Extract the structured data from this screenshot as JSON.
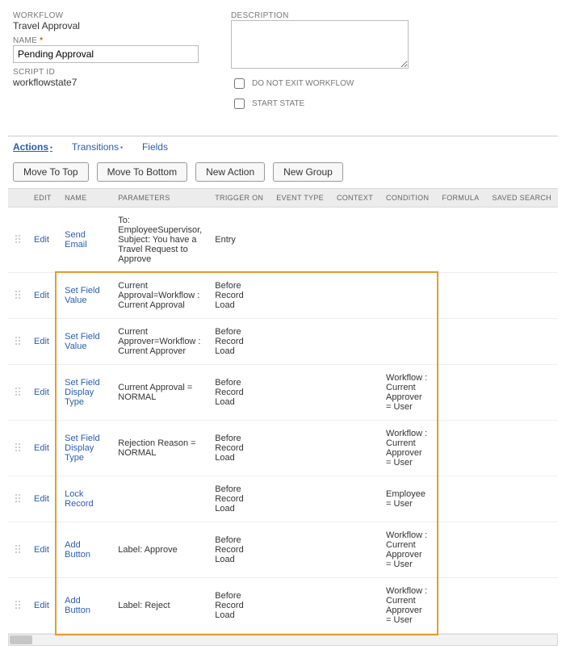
{
  "form": {
    "workflow_label": "WORKFLOW",
    "workflow_value": "Travel Approval",
    "name_label": "NAME",
    "name_value": "Pending Approval",
    "scriptid_label": "SCRIPT ID",
    "scriptid_value": "workflowstate7",
    "description_label": "DESCRIPTION",
    "description_value": "",
    "donotexit_label": "DO NOT EXIT WORKFLOW",
    "startstate_label": "START STATE"
  },
  "tabs": {
    "actions": "Actions",
    "transitions": "Transitions",
    "fields": "Fields"
  },
  "buttons": {
    "move_top": "Move To Top",
    "move_bottom": "Move To Bottom",
    "new_action": "New Action",
    "new_group": "New Group"
  },
  "columns": {
    "edit": "EDIT",
    "name": "NAME",
    "parameters": "PARAMETERS",
    "trigger_on": "TRIGGER ON",
    "event_type": "EVENT TYPE",
    "context": "CONTEXT",
    "condition": "CONDITION",
    "formula": "FORMULA",
    "saved_search": "SAVED SEARCH"
  },
  "edit_label": "Edit",
  "rows": [
    {
      "name": "Send Email",
      "parameters": "To: EmployeeSupervisor, Subject: You have a Travel Request to Approve",
      "trigger": "Entry",
      "event": "",
      "context": "",
      "condition": "",
      "formula": "",
      "saved_search": ""
    },
    {
      "name": "Set Field Value",
      "parameters": "Current Approval=Workflow : Current Approval",
      "trigger": "Before Record Load",
      "event": "",
      "context": "",
      "condition": "",
      "formula": "",
      "saved_search": ""
    },
    {
      "name": "Set Field Value",
      "parameters": "Current Approver=Workflow : Current Approver",
      "trigger": "Before Record Load",
      "event": "",
      "context": "",
      "condition": "",
      "formula": "",
      "saved_search": ""
    },
    {
      "name": "Set Field Display Type",
      "parameters": "Current Approval = NORMAL",
      "trigger": "Before Record Load",
      "event": "",
      "context": "",
      "condition": "Workflow : Current Approver = User",
      "formula": "",
      "saved_search": ""
    },
    {
      "name": "Set Field Display Type",
      "parameters": "Rejection Reason = NORMAL",
      "trigger": "Before Record Load",
      "event": "",
      "context": "",
      "condition": "Workflow : Current Approver = User",
      "formula": "",
      "saved_search": ""
    },
    {
      "name": "Lock Record",
      "parameters": "",
      "trigger": "Before Record Load",
      "event": "",
      "context": "",
      "condition": "Employee = User",
      "formula": "",
      "saved_search": ""
    },
    {
      "name": "Add Button",
      "parameters": "Label: Approve",
      "trigger": "Before Record Load",
      "event": "",
      "context": "",
      "condition": "Workflow : Current Approver = User",
      "formula": "",
      "saved_search": ""
    },
    {
      "name": "Add Button",
      "parameters": "Label: Reject",
      "trigger": "Before Record Load",
      "event": "",
      "context": "",
      "condition": "Workflow : Current Approver = User",
      "formula": "",
      "saved_search": ""
    }
  ]
}
